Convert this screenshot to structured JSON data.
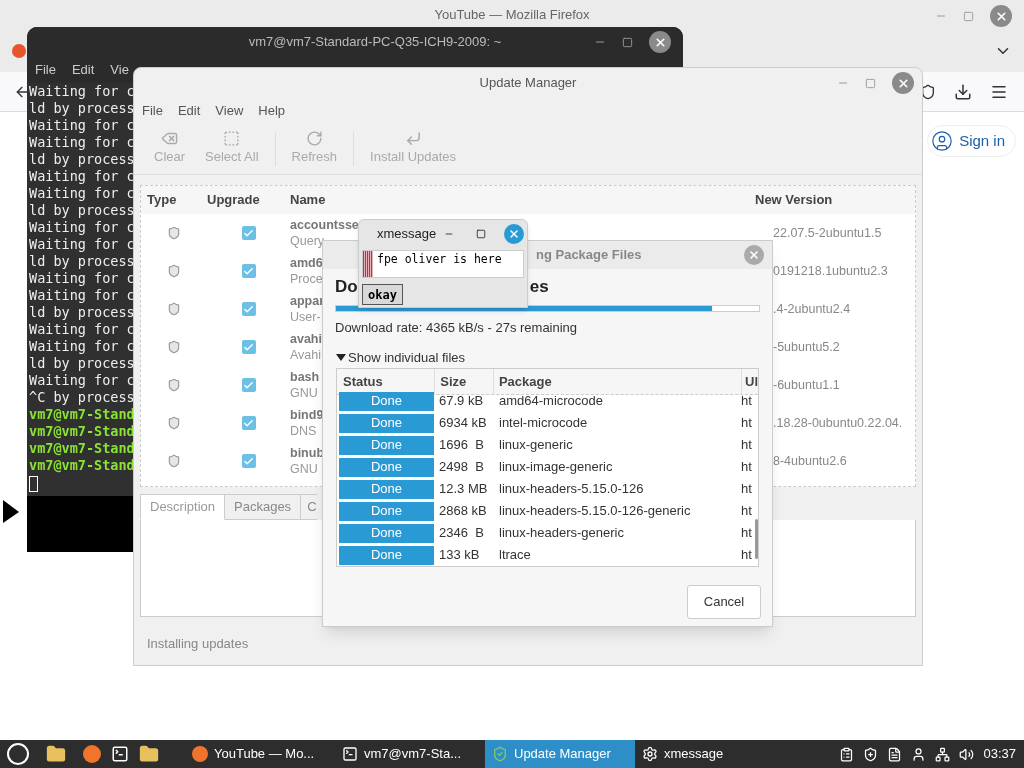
{
  "firefox": {
    "title": "YouTube — Mozilla Firefox",
    "sign_in": "Sign in"
  },
  "terminal": {
    "title": "vm7@vm7-Standard-PC-Q35-ICH9-2009: ~",
    "menu": [
      "File",
      "Edit",
      "Vie"
    ],
    "lines": [
      {
        "text": "Waiting for c",
        "kind": "output"
      },
      {
        "text": "ld by process",
        "kind": "output"
      },
      {
        "text": "Waiting for c",
        "kind": "output"
      },
      {
        "text": "Waiting for c",
        "kind": "output"
      },
      {
        "text": "ld by process",
        "kind": "output"
      },
      {
        "text": "Waiting for c",
        "kind": "output"
      },
      {
        "text": "Waiting for c",
        "kind": "output"
      },
      {
        "text": "ld by process",
        "kind": "output"
      },
      {
        "text": "Waiting for c",
        "kind": "output"
      },
      {
        "text": "Waiting for c",
        "kind": "output"
      },
      {
        "text": "ld by process",
        "kind": "output"
      },
      {
        "text": "Waiting for c",
        "kind": "output"
      },
      {
        "text": "Waiting for c",
        "kind": "output"
      },
      {
        "text": "ld by process",
        "kind": "output"
      },
      {
        "text": "Waiting for c",
        "kind": "output"
      },
      {
        "text": "Waiting for c",
        "kind": "output"
      },
      {
        "text": "ld by process",
        "kind": "output"
      },
      {
        "text": "Waiting for c",
        "kind": "output"
      },
      {
        "text": "^C by process",
        "kind": "output"
      },
      {
        "text": "vm7@vm7-Stand",
        "kind": "prompt"
      },
      {
        "text": "vm7@vm7-Stand",
        "kind": "prompt"
      },
      {
        "text": "vm7@vm7-Stand",
        "kind": "prompt"
      },
      {
        "text": "vm7@vm7-Stand",
        "kind": "prompt"
      }
    ]
  },
  "update_manager": {
    "title": "Update Manager",
    "menu": [
      "File",
      "Edit",
      "View",
      "Help"
    ],
    "toolbar": [
      {
        "label": "Clear",
        "kind": "clear",
        "disabled": true
      },
      {
        "label": "Select All",
        "kind": "select_all",
        "disabled": true
      },
      {
        "label": "Refresh",
        "kind": "refresh",
        "disabled": true
      },
      {
        "label": "Install Updates",
        "kind": "install",
        "disabled": true
      }
    ],
    "columns": [
      "Type",
      "Upgrade",
      "Name",
      "New Version"
    ],
    "rows": [
      {
        "name": "accountsse",
        "description": "Query",
        "version": "22.07.5-2ubuntu1.5",
        "upgrade": true
      },
      {
        "name": "amd6",
        "description": "Proce",
        "version": "0191218.1ubuntu2.3",
        "upgrade": true
      },
      {
        "name": "appar",
        "description": "User-",
        "version": ".4-2ubuntu2.4",
        "upgrade": true
      },
      {
        "name": "avahi",
        "description": "Avahi",
        "version": "-5ubuntu5.2",
        "upgrade": true
      },
      {
        "name": "bash",
        "description": "GNU",
        "version": "-6ubuntu1.1",
        "upgrade": true
      },
      {
        "name": "bind9",
        "description": "DNS",
        "version": ".18.28-0ubuntu0.22.04.",
        "upgrade": true
      },
      {
        "name": "binub",
        "description": "GNU",
        "version": "8-4ubuntu2.6",
        "upgrade": true
      }
    ],
    "tabs": [
      {
        "label": "Description",
        "selected": true
      },
      {
        "label": "Packages",
        "selected": false
      },
      {
        "label": "C",
        "selected": false
      }
    ],
    "status": "Installing updates"
  },
  "download_dialog": {
    "title": "ng Package Files",
    "heading": [
      "Do",
      "es"
    ],
    "level": 0.89,
    "rate": "Download rate: 4365 kB/s - 27s remaining",
    "expander": {
      "label": "Show individual files",
      "expanded": true
    },
    "columns": [
      "Status",
      "Size",
      "Package",
      "Ul"
    ],
    "files": [
      {
        "status": "Done",
        "size": "67.9 kB",
        "package": "amd64-microcode",
        "url": "ht"
      },
      {
        "status": "Done",
        "size": "6934 kB",
        "package": "intel-microcode",
        "url": "ht"
      },
      {
        "status": "Done",
        "size": "1696  B",
        "package": "linux-generic",
        "url": "ht"
      },
      {
        "status": "Done",
        "size": "2498  B",
        "package": "linux-image-generic",
        "url": "ht"
      },
      {
        "status": "Done",
        "size": "12.3 MB",
        "package": "linux-headers-5.15.0-126",
        "url": "ht"
      },
      {
        "status": "Done",
        "size": "2868 kB",
        "package": "linux-headers-5.15.0-126-generic",
        "url": "ht"
      },
      {
        "status": "Done",
        "size": "2346  B",
        "package": "linux-headers-generic",
        "url": "ht"
      },
      {
        "status": "Done",
        "size": "133 kB",
        "package": "ltrace",
        "url": "ht"
      }
    ],
    "cancel": "Cancel"
  },
  "xmessage": {
    "title": "xmessage",
    "message": "fpe oliver is here",
    "button": "okay"
  },
  "taskbar": {
    "tasks": [
      {
        "label": "YouTube — Mo...",
        "kind": "firefox",
        "selected": false
      },
      {
        "label": "vm7@vm7-Sta...",
        "kind": "terminal",
        "selected": false
      },
      {
        "label": "Update Manager",
        "kind": "shield",
        "selected": true
      },
      {
        "label": "xmessage",
        "kind": "gear",
        "selected": false
      }
    ],
    "clock": "03:37"
  }
}
